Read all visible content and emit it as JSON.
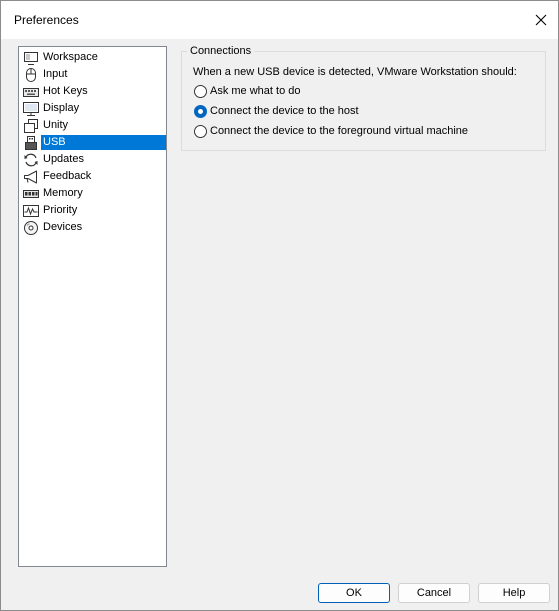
{
  "window": {
    "title": "Preferences"
  },
  "nav": {
    "items": [
      {
        "label": "Workspace",
        "icon": "workspace-icon"
      },
      {
        "label": "Input",
        "icon": "mouse-icon"
      },
      {
        "label": "Hot Keys",
        "icon": "keyboard-icon"
      },
      {
        "label": "Display",
        "icon": "monitor-icon"
      },
      {
        "label": "Unity",
        "icon": "unity-icon"
      },
      {
        "label": "USB",
        "icon": "usb-icon"
      },
      {
        "label": "Updates",
        "icon": "refresh-icon"
      },
      {
        "label": "Feedback",
        "icon": "megaphone-icon"
      },
      {
        "label": "Memory",
        "icon": "memory-icon"
      },
      {
        "label": "Priority",
        "icon": "priority-icon"
      },
      {
        "label": "Devices",
        "icon": "disc-icon"
      }
    ],
    "selected": "USB"
  },
  "connections": {
    "title": "Connections",
    "description": "When a new USB device is detected, VMware Workstation should:",
    "options": [
      {
        "label": "Ask me what to do",
        "checked": false
      },
      {
        "label": "Connect the device to the host",
        "checked": true
      },
      {
        "label": "Connect the device to the foreground virtual machine",
        "checked": false
      }
    ]
  },
  "buttons": {
    "ok": "OK",
    "cancel": "Cancel",
    "help": "Help"
  },
  "colors": {
    "selection": "#0078d7",
    "radio_accent": "#0067c0",
    "default_button_border": "#005fb8"
  }
}
